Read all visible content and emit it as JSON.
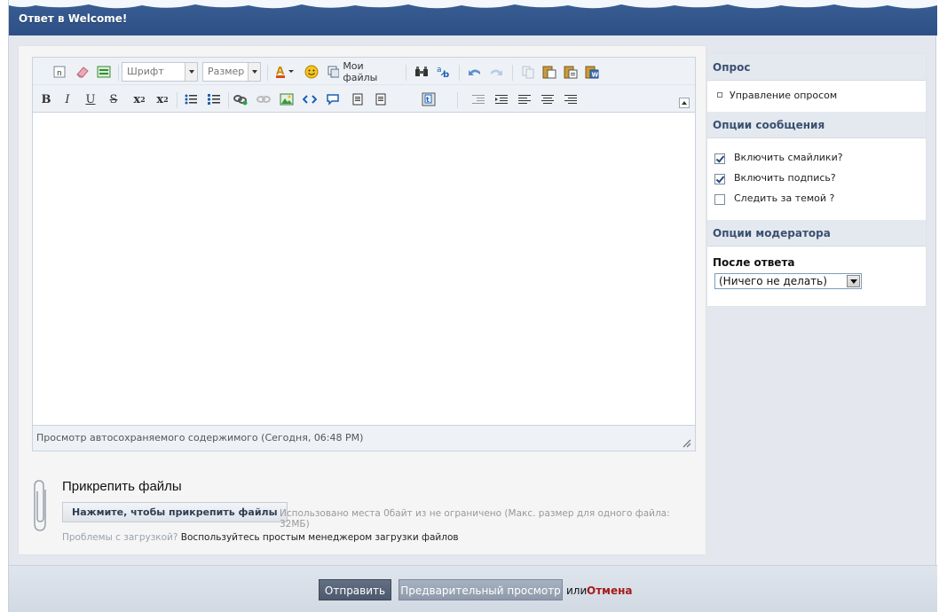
{
  "header": {
    "title": "Ответ в Welcome!"
  },
  "toolbar": {
    "font_placeholder": "Шрифт",
    "size_placeholder": "Размер",
    "my_files_label": "Мои файлы",
    "bold": "B",
    "italic": "I",
    "underline": "U",
    "strike": "S",
    "subscript_base": "x",
    "subscript_mark": "2",
    "superscript_base": "x",
    "superscript_mark": "2"
  },
  "editor": {
    "autosave_text": "Просмотр автосохраняемого содержимого (Сегодня, 06:48 PM)"
  },
  "attachments": {
    "title": "Прикрепить файлы",
    "button_label": "Нажмите, чтобы прикрепить файлы",
    "quota_text": "Использовано места 0байт из не ограничено (Макс. размер для одного файла: 32МБ)",
    "problem_question": "Проблемы с загрузкой?",
    "simple_manager_link": "Воспользуйтесь простым менеджером загрузки файлов"
  },
  "sidebar": {
    "poll": {
      "title": "Опрос",
      "manage_label": "Управление опросом"
    },
    "post_options": {
      "title": "Опции сообщения",
      "options": [
        {
          "label": "Включить смайлики?",
          "checked": true
        },
        {
          "label": "Включить подпись?",
          "checked": true
        },
        {
          "label": "Следить за темой ?",
          "checked": false
        }
      ]
    },
    "moderator": {
      "title": "Опции модератора",
      "after_reply_label": "После ответа",
      "after_reply_value": "(Ничего не делать)"
    }
  },
  "footer": {
    "submit_label": "Отправить",
    "preview_label": "Предварительный просмотр",
    "or_text": "или",
    "cancel_label": "Отмена"
  },
  "colors": {
    "header_bg": "#2d4f85",
    "submit_bg": "#4d5a6d",
    "preview_bg": "#8e9aab",
    "cancel_link": "#a51b1b"
  }
}
